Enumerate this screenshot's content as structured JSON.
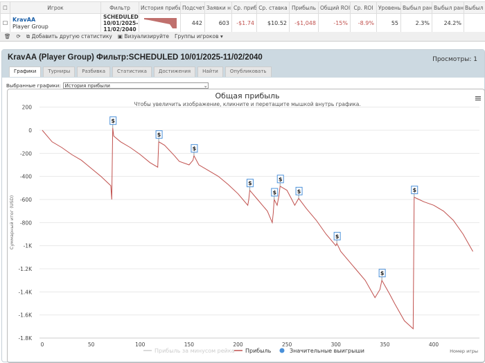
{
  "table": {
    "headers": [
      "Игрок",
      "Фильтр",
      "История прибы",
      "Подсчет",
      "Заявки н",
      "Ср. приб",
      "Ср. ставка",
      "Прибыль",
      "Общий ROI",
      "Ср. ROI",
      "Уровень",
      "Выбыл ран",
      "Выбыл рано/",
      "Выбыл"
    ],
    "row": {
      "player": "KravAA",
      "group": "Player Group",
      "filter": "SCHEDULED 10/01/2025-11/02/2040",
      "count": "442",
      "entries": "603",
      "avg_profit": "-$1.74",
      "avg_stake": "$10.52",
      "profit": "-$1,048",
      "total_roi": "-15%",
      "avg_roi": "-8.9%",
      "level": "55",
      "early1": "2.3%",
      "early2": "24.2%",
      "last": ""
    }
  },
  "toolbar": {
    "add_stat": "Добавить другую статистику",
    "visualize": "Визуализируйте",
    "groups": "Группы игроков ▾"
  },
  "panel": {
    "title": "KravAA (Player Group) Фильтр:SCHEDULED 10/01/2025-11/02/2040",
    "views": "Просмотры: 1",
    "tabs": [
      "Графики",
      "Турниры",
      "Разбивка",
      "Статистика",
      "Достижения",
      "Найти",
      "Опубликовать"
    ],
    "select_label": "Выбранные графики:",
    "select_value": "История прибыли"
  },
  "chart_data": {
    "type": "line",
    "title": "Общая прибыль",
    "subtitle": "Чтобы увеличить изображение, кликните и перетащите мышкой внутрь графика.",
    "xlabel": "Номер игры",
    "ylabel": "Суммарный итог (USD)",
    "xlim": [
      0,
      442
    ],
    "ylim": [
      -1800,
      200
    ],
    "xticks": [
      "0",
      "50",
      "100",
      "150",
      "200",
      "250",
      "300",
      "350",
      "400"
    ],
    "yticks": [
      "200",
      "0",
      "-200",
      "-400",
      "-600",
      "-800",
      "-1K",
      "-1.2K",
      "-1.4K",
      "-1.6K",
      "-1.8K"
    ],
    "legend": [
      "Прибыль за минусом рейка",
      "Прибыль",
      "Значительные выигрыши"
    ],
    "colors": {
      "line": "#c0504d",
      "marker": "#4a90d9"
    },
    "series": [
      {
        "name": "Прибыль",
        "x": [
          0,
          10,
          20,
          30,
          40,
          50,
          60,
          70,
          71,
          72,
          73,
          80,
          90,
          100,
          110,
          118,
          119,
          125,
          135,
          140,
          150,
          154,
          155,
          160,
          170,
          180,
          190,
          200,
          210,
          211,
          212,
          220,
          230,
          235,
          236,
          237,
          240,
          242,
          243,
          246,
          250,
          255,
          258,
          262,
          270,
          280,
          290,
          300,
          301,
          305,
          310,
          320,
          330,
          340,
          345,
          347,
          355,
          360,
          370,
          379,
          380,
          385,
          390,
          400,
          410,
          420,
          430,
          440
        ],
        "y": [
          0,
          -100,
          -150,
          -210,
          -260,
          -330,
          -400,
          -480,
          -600,
          20,
          -50,
          -100,
          -150,
          -210,
          -280,
          -320,
          -100,
          -130,
          -220,
          -270,
          -300,
          -260,
          -220,
          -300,
          -350,
          -400,
          -470,
          -550,
          -650,
          -600,
          -520,
          -600,
          -700,
          -800,
          -720,
          -600,
          -650,
          -560,
          -485,
          -500,
          -520,
          -600,
          -650,
          -590,
          -680,
          -780,
          -900,
          -1000,
          -980,
          -1050,
          -1100,
          -1200,
          -1300,
          -1450,
          -1380,
          -1300,
          -1420,
          -1500,
          -1650,
          -1720,
          -580,
          -600,
          -620,
          -650,
          -700,
          -780,
          -900,
          -1050
        ]
      }
    ],
    "big_wins_x": [
      72,
      119,
      155,
      212,
      237,
      243,
      262,
      301,
      347,
      380
    ],
    "big_wins_label": "$"
  }
}
